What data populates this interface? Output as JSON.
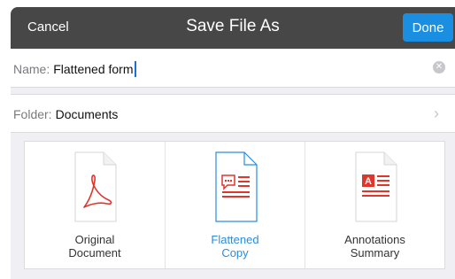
{
  "header": {
    "cancel_label": "Cancel",
    "title": "Save File As",
    "done_label": "Done"
  },
  "name_field": {
    "label": "Name:",
    "value": "Flattened form",
    "clear_icon": "clear-circle-icon"
  },
  "folder_field": {
    "label": "Folder:",
    "value": "Documents",
    "chevron_icon": "chevron-right-icon"
  },
  "options": [
    {
      "line1": "Original",
      "line2": "Document",
      "icon": "pdf-document-icon",
      "selected": false
    },
    {
      "line1": "Flattened",
      "line2": "Copy",
      "icon": "flattened-comment-document-icon",
      "selected": true
    },
    {
      "line1": "Annotations",
      "line2": "Summary",
      "icon": "annotations-summary-document-icon",
      "selected": false
    }
  ],
  "colors": {
    "titlebar": "#474747",
    "accent": "#1a8fe2",
    "selected_text": "#2a8ddf",
    "pdf_red": "#e0352b"
  }
}
